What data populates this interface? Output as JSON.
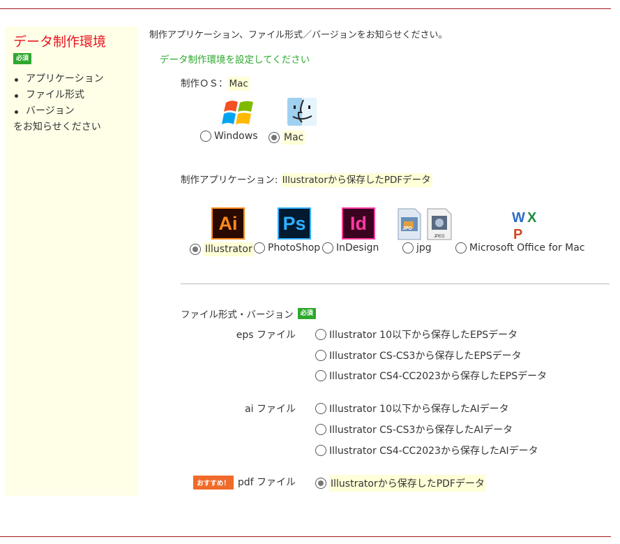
{
  "sidebar": {
    "title": "データ制作環境",
    "required_badge": "必須",
    "items": [
      "アプリケーション",
      "ファイル形式",
      "バージョン"
    ],
    "note": "をお知らせください"
  },
  "main": {
    "intro": "制作アプリケーション、ファイル形式／バージョンをお知らせください。",
    "heading": "データ制作環境を設定してください",
    "os": {
      "label": "制作ＯＳ：",
      "value": "Mac",
      "options": [
        {
          "label": "Windows",
          "checked": false,
          "icon": "windows-logo-icon"
        },
        {
          "label": "Mac",
          "checked": true,
          "icon": "mac-finder-icon"
        }
      ]
    },
    "app": {
      "label": "制作アプリケーション:",
      "value": "Illustratorから保存したPDFデータ",
      "options": [
        {
          "label": "Illustrator",
          "checked": true,
          "icon_text": "Ai",
          "icon_bg": "#2a0a00",
          "icon_fg": "#ff8a1c"
        },
        {
          "label": "PhotoShop",
          "checked": false,
          "icon_text": "Ps",
          "icon_bg": "#001a30",
          "icon_fg": "#2fb0ff"
        },
        {
          "label": "InDesign",
          "checked": false,
          "icon_text": "Id",
          "icon_bg": "#3a0320",
          "icon_fg": "#ff3aa0"
        },
        {
          "label": "jpg",
          "checked": false,
          "icon": "jpg-file-icon",
          "icon_text_a": "JPG",
          "icon_text_b": "JPEG"
        },
        {
          "label": "Microsoft Office for Mac",
          "checked": false,
          "icon": "ms-office-icon",
          "icon_letters": [
            "W",
            "X",
            "P"
          ]
        }
      ]
    },
    "format": {
      "label": "ファイル形式・バージョン",
      "required_badge": "必須",
      "recommend_badge": "おすすめ！",
      "groups": [
        {
          "label": "eps ファイル",
          "options": [
            {
              "label": "Illustrator 10以下から保存したEPSデータ",
              "checked": false
            },
            {
              "label": "Illustrator CS-CS3から保存したEPSデータ",
              "checked": false
            },
            {
              "label": "Illustrator CS4-CC2023から保存したEPSデータ",
              "checked": false
            }
          ]
        },
        {
          "label": "ai ファイル",
          "options": [
            {
              "label": "Illustrator 10以下から保存したAIデータ",
              "checked": false
            },
            {
              "label": "Illustrator CS-CS3から保存したAIデータ",
              "checked": false
            },
            {
              "label": "Illustrator CS4-CC2023から保存したAIデータ",
              "checked": false
            }
          ]
        },
        {
          "label": "pdf ファイル",
          "options": [
            {
              "label": "Illustratorから保存したPDFデータ",
              "checked": true
            }
          ]
        }
      ]
    }
  },
  "colors": {
    "accent_red": "#e8141e",
    "rule": "#a5141e",
    "green": "#2ea82e",
    "orange": "#f06a2a",
    "sidebar_bg": "#ffffe8"
  }
}
